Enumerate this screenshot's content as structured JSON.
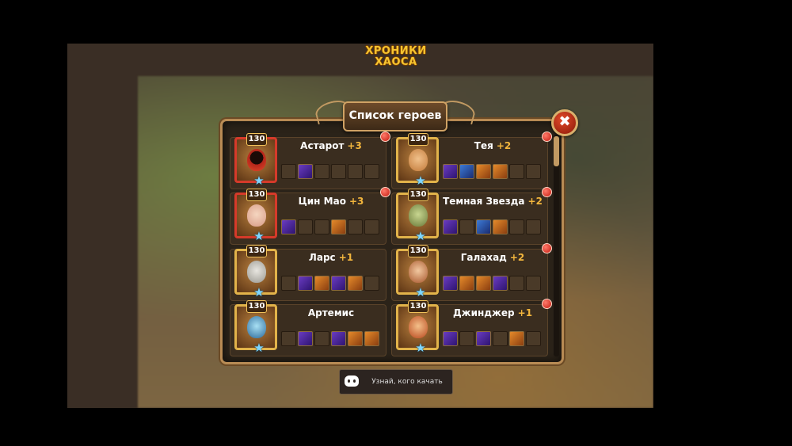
{
  "logo": {
    "line1": "ХРОНИКИ",
    "line2": "ХАОСА"
  },
  "dialog": {
    "title": "Список героев",
    "close_symbol": "✖"
  },
  "heroes": [
    {
      "name": "Астарот",
      "plus": "+3",
      "level": "130",
      "star_icon": "star-icon",
      "has_notification": true
    },
    {
      "name": "Тея",
      "plus": "+2",
      "level": "130",
      "star_icon": "star-icon",
      "has_notification": true
    },
    {
      "name": "Цин Мао",
      "plus": "+3",
      "level": "130",
      "star_icon": "star-icon",
      "has_notification": true
    },
    {
      "name": "Темная Звезда",
      "plus": "+2",
      "level": "130",
      "star_icon": "star-icon",
      "has_notification": true
    },
    {
      "name": "Ларс",
      "plus": "+1",
      "level": "130",
      "star_icon": "star-icon",
      "has_notification": false
    },
    {
      "name": "Галахад",
      "plus": "+2",
      "level": "130",
      "star_icon": "star-icon",
      "has_notification": true
    },
    {
      "name": "Артемис",
      "plus": "",
      "level": "130",
      "star_icon": "star-icon",
      "has_notification": false
    },
    {
      "name": "Джинджер",
      "plus": "+1",
      "level": "130",
      "star_icon": "star-icon",
      "has_notification": true
    }
  ],
  "footer": {
    "discord_label": "Узнай, кого качать",
    "discord_icon": "discord-icon"
  },
  "colors": {
    "accent_gold": "#f6c531",
    "plus_orange": "#f3b63d",
    "notification_red": "#c41b10",
    "star_blue": "#7fd6ff"
  }
}
